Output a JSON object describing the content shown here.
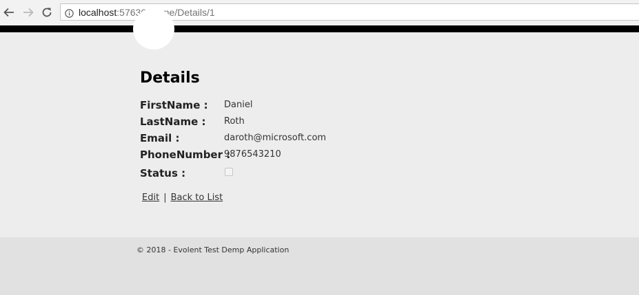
{
  "browser": {
    "url_host": "localhost",
    "url_rest": ":57636/Home/Details/1"
  },
  "page": {
    "title": "Details"
  },
  "details": [
    {
      "label": "FirstName :",
      "value": "Daniel"
    },
    {
      "label": "LastName :",
      "value": "Roth"
    },
    {
      "label": "Email :",
      "value": "daroth@microsoft.com"
    },
    {
      "label": "PhoneNumber :",
      "value": "9876543210"
    }
  ],
  "status": {
    "label": "Status :",
    "checked": false
  },
  "actions": {
    "edit_label": "Edit",
    "separator": "|",
    "back_label": "Back to List"
  },
  "footer": {
    "text": "© 2018 - Evolent Test Demp Application"
  }
}
